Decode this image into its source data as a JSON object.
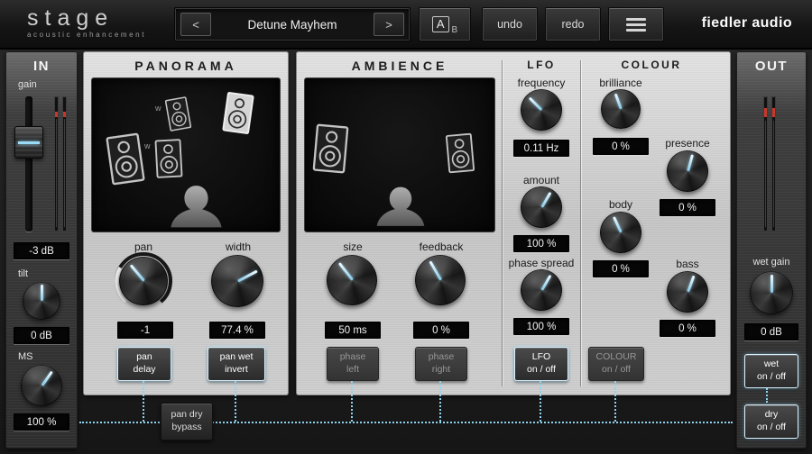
{
  "header": {
    "logo_title": "stage",
    "logo_subtitle": "acoustic enhancement",
    "preset": {
      "prev": "<",
      "name": "Detune Mayhem",
      "next": ">"
    },
    "ab": {
      "a": "A",
      "b": "B"
    },
    "undo": "undo",
    "redo": "redo",
    "brand": "fiedler audio"
  },
  "input": {
    "title": "IN",
    "gain_label": "gain",
    "gain_value": "-3 dB",
    "tilt_label": "tilt",
    "tilt_value": "0 dB",
    "ms_label": "MS",
    "ms_value": "100 %"
  },
  "panorama": {
    "title": "PANORAMA",
    "marker_w1": "w",
    "marker_w2": "w",
    "pan_label": "pan",
    "pan_value": "-1",
    "width_label": "width",
    "width_value": "77.4 %",
    "pan_delay_button": "pan\ndelay",
    "pan_wet_invert_button": "pan wet\ninvert"
  },
  "ambience": {
    "title": "AMBIENCE",
    "size_label": "size",
    "size_value": "50 ms",
    "feedback_label": "feedback",
    "feedback_value": "0 %",
    "phase_left_button": "phase\nleft",
    "phase_right_button": "phase\nright"
  },
  "lfo": {
    "title": "LFO",
    "frequency_label": "frequency",
    "frequency_value": "0.11 Hz",
    "amount_label": "amount",
    "amount_value": "100 %",
    "phase_spread_label": "phase spread",
    "phase_spread_value": "100 %",
    "onoff_button": "LFO\non / off"
  },
  "colour": {
    "title": "COLOUR",
    "brilliance_label": "brilliance",
    "brilliance_value": "0 %",
    "presence_label": "presence",
    "presence_value": "0 %",
    "body_label": "body",
    "body_value": "0 %",
    "bass_label": "bass",
    "bass_value": "0 %",
    "onoff_button": "COLOUR\non / off"
  },
  "output": {
    "title": "OUT",
    "wet_gain_label": "wet gain",
    "wet_gain_value": "0 dB",
    "wet_button": "wet\non / off",
    "dry_button": "dry\non / off"
  },
  "routing": {
    "pan_dry_bypass_button": "pan dry\nbypass"
  },
  "colors": {
    "accent": "#8ed2ee",
    "panel_light": "#cecece",
    "bg_dark": "#1b1b1b",
    "meter_peak_red": "#c9372c"
  }
}
